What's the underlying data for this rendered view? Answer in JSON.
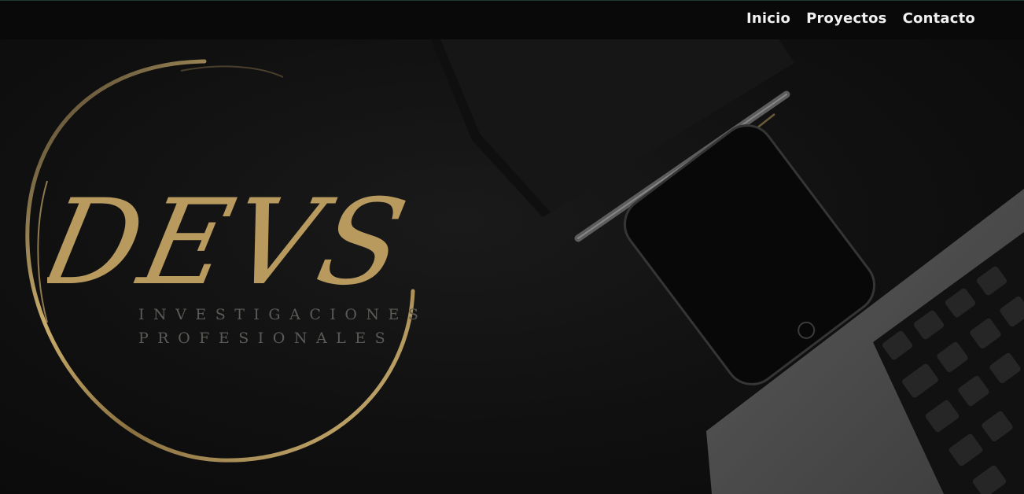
{
  "nav": {
    "items": [
      {
        "label": "Inicio"
      },
      {
        "label": "Proyectos"
      },
      {
        "label": "Contacto"
      }
    ]
  },
  "logo": {
    "monogram": "DEVS",
    "tagline_line1": "INVESTIGACIONES",
    "tagline_line2": "PROFESIONALES"
  },
  "colors": {
    "gold": "#b89a5e",
    "background": "#0b0b0b"
  }
}
